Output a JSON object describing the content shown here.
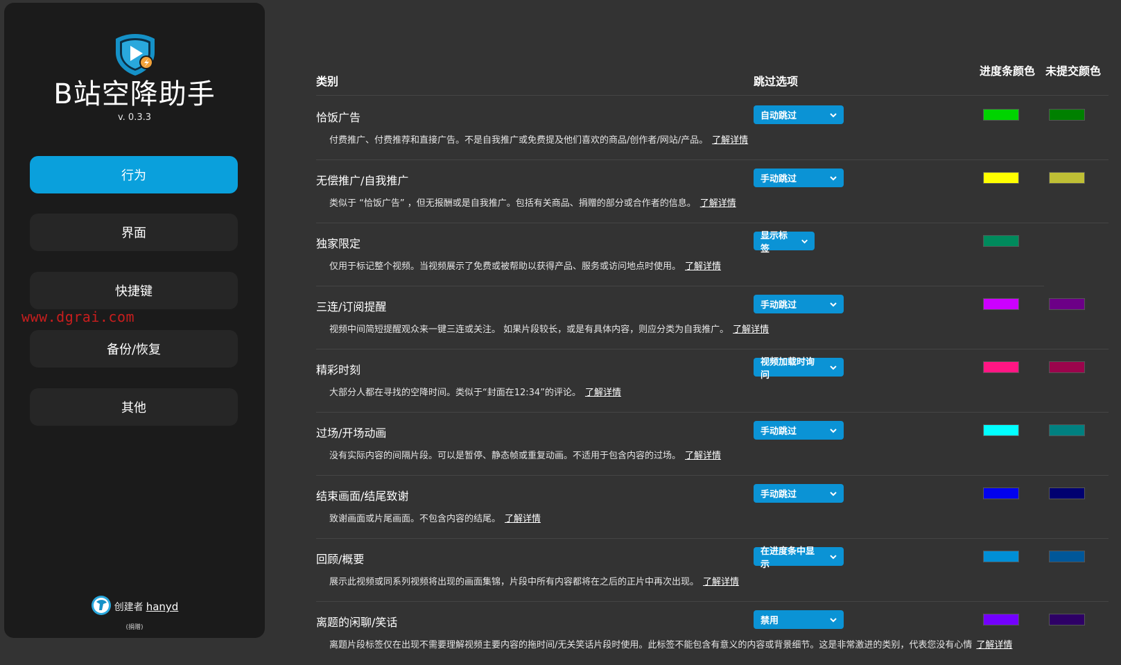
{
  "app": {
    "title": "B站空降助手",
    "version": "v. 0.3.3"
  },
  "sidebar": {
    "items": [
      {
        "label": "行为",
        "active": true
      },
      {
        "label": "界面",
        "active": false
      },
      {
        "label": "快捷键",
        "active": false
      },
      {
        "label": "备份/恢复",
        "active": false
      },
      {
        "label": "其他",
        "active": false
      }
    ],
    "watermark": "www.dgrai.com",
    "footer": {
      "creator_label": "创建者",
      "creator_name": "hanyd",
      "small_note": "(捐赠)"
    }
  },
  "table": {
    "headers": {
      "category": "类别",
      "skip_option": "跳过选项",
      "bar_color": "进度条颜色",
      "unsubmitted_color": "未提交颜色"
    },
    "more_label": "了解详情",
    "rows": [
      {
        "name": "恰饭广告",
        "desc": "付费推广、付费推荐和直接广告。不是自我推广或免费提及他们喜欢的商品/创作者/网站/产品。",
        "option": "自动跳过",
        "bar_color": "#00d400",
        "unsub_color": "#008000"
      },
      {
        "name": "无偿推广/自我推广",
        "desc": "类似于 “恰饭广告” ，但无报酬或是自我推广。包括有关商品、捐赠的部分或合作者的信息。",
        "option": "手动跳过",
        "bar_color": "#ffff00",
        "unsub_color": "#bfbf35"
      },
      {
        "name": "独家限定",
        "desc": "仅用于标记整个视频。当视频展示了免费或被帮助以获得产品、服务或访问地点时使用。",
        "option": "显示标签",
        "bar_color": "#008a5c",
        "unsub_color": ""
      },
      {
        "name": "三连/订阅提醒",
        "desc": "视频中间简短提醒观众来一键三连或关注。 如果片段较长，或是有具体内容，则应分类为自我推广。",
        "option": "手动跳过",
        "bar_color": "#cc00ff",
        "unsub_color": "#6c0087"
      },
      {
        "name": "精彩时刻",
        "desc": "大部分人都在寻找的空降时间。类似于“封面在12:34”的评论。",
        "option": "视频加载时询问",
        "bar_color": "#ff1684",
        "unsub_color": "#9b044c"
      },
      {
        "name": "过场/开场动画",
        "desc": "没有实际内容的间隔片段。可以是暂停、静态帧或重复动画。不适用于包含内容的过场。",
        "option": "手动跳过",
        "bar_color": "#00ffff",
        "unsub_color": "#008080"
      },
      {
        "name": "结束画面/结尾致谢",
        "desc": "致谢画面或片尾画面。不包含内容的结尾。",
        "option": "手动跳过",
        "bar_color": "#0202ed",
        "unsub_color": "#000070"
      },
      {
        "name": "回顾/概要",
        "desc": "展示此视频或同系列视频将出现的画面集锦，片段中所有内容都将在之后的正片中再次出现。",
        "option": "在进度条中显示",
        "bar_color": "#008fd6",
        "unsub_color": "#005799"
      },
      {
        "name": "离题的闲聊/笑话",
        "desc": "离题片段标签仅在出现不需要理解视频主要内容的拖时间/无关笑话片段时使用。此标签不能包含有意义的内容或背景细节。这是非常激进的类别，代表您没有心情",
        "option": "禁用",
        "bar_color": "#7300ff",
        "unsub_color": "#2e0066"
      }
    ]
  },
  "colors": {
    "accent": "#0aa0dc",
    "select_bg": "#0b93d5",
    "sidebar_bg": "#1b1b1b",
    "page_bg": "#333333"
  },
  "icons": {
    "logo": "shield-play-logo-icon",
    "dropdown": "chevron-down-icon",
    "creator_avatar": "avatar-icon"
  }
}
